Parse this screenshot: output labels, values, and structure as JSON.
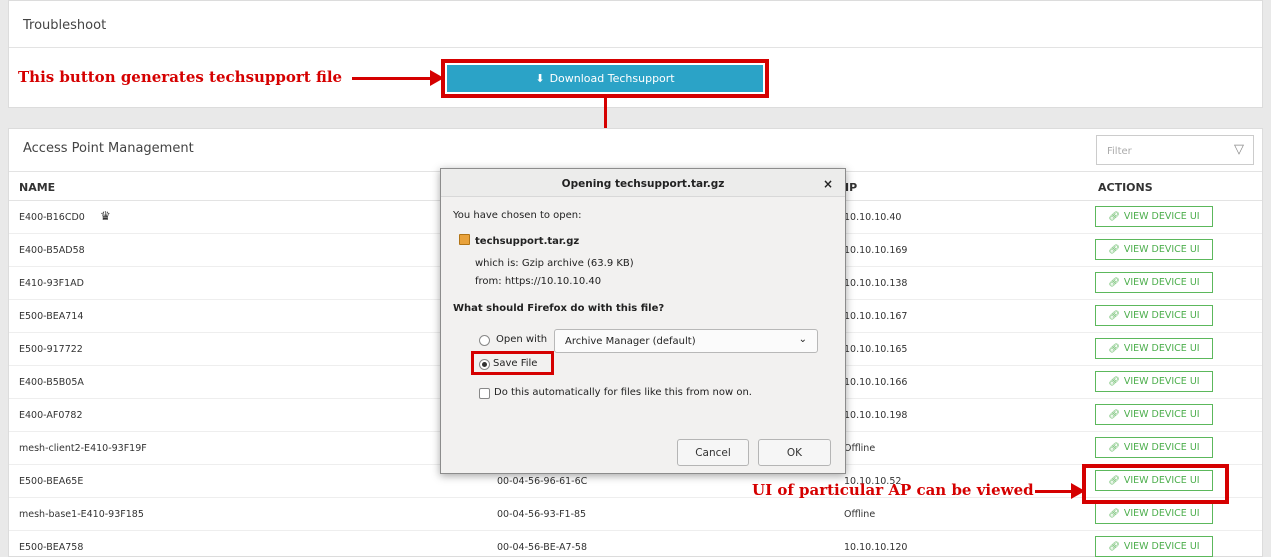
{
  "troubleshoot": {
    "title": "Troubleshoot",
    "download_label": "Download Techsupport"
  },
  "annotations": {
    "button_note": "This button generates techsupport file",
    "ap_note": "UI of particular AP can be viewed",
    "color": "#d50000"
  },
  "apm": {
    "title": "Access Point Management",
    "filter_placeholder": "Filter",
    "columns": {
      "name": "NAME",
      "ip": "IP",
      "actions": "ACTIONS"
    },
    "view_label": "VIEW DEVICE UI",
    "rows": [
      {
        "name": "E400-B16CD0",
        "mac": "",
        "ip": "10.10.10.40",
        "crown": true
      },
      {
        "name": "E400-B5AD58",
        "mac": "",
        "ip": "10.10.10.169"
      },
      {
        "name": "E410-93F1AD",
        "mac": "",
        "ip": "10.10.10.138"
      },
      {
        "name": "E500-BEA714",
        "mac": "",
        "ip": "10.10.10.167"
      },
      {
        "name": "E500-917722",
        "mac": "",
        "ip": "10.10.10.165"
      },
      {
        "name": "E400-B5B05A",
        "mac": "",
        "ip": "10.10.10.166"
      },
      {
        "name": "E400-AF0782",
        "mac": "",
        "ip": "10.10.10.198"
      },
      {
        "name": "mesh-client2-E410-93F19F",
        "mac": "",
        "ip": "Offline"
      },
      {
        "name": "E500-BEA65E",
        "mac": "00-04-56-96-61-6C",
        "ip": "10.10.10.52"
      },
      {
        "name": "mesh-base1-E410-93F185",
        "mac": "00-04-56-93-F1-85",
        "ip": "Offline"
      },
      {
        "name": "E500-BEA758",
        "mac": "00-04-56-BE-A7-58",
        "ip": "10.10.10.120"
      }
    ]
  },
  "dialog": {
    "title": "Opening techsupport.tar.gz",
    "chosen": "You have chosen to open:",
    "filename": "techsupport.tar.gz",
    "which_is": "which is: Gzip archive (63.9 KB)",
    "from": "from: https://10.10.10.40",
    "question": "What should Firefox do with this file?",
    "open_with": "Open with",
    "app": "Archive Manager (default)",
    "save_file": "Save File",
    "auto": "Do this automatically for files like this from now on.",
    "cancel": "Cancel",
    "ok": "OK"
  },
  "colors": {
    "primary": "#2ba3c7",
    "success": "#4cae4c"
  }
}
